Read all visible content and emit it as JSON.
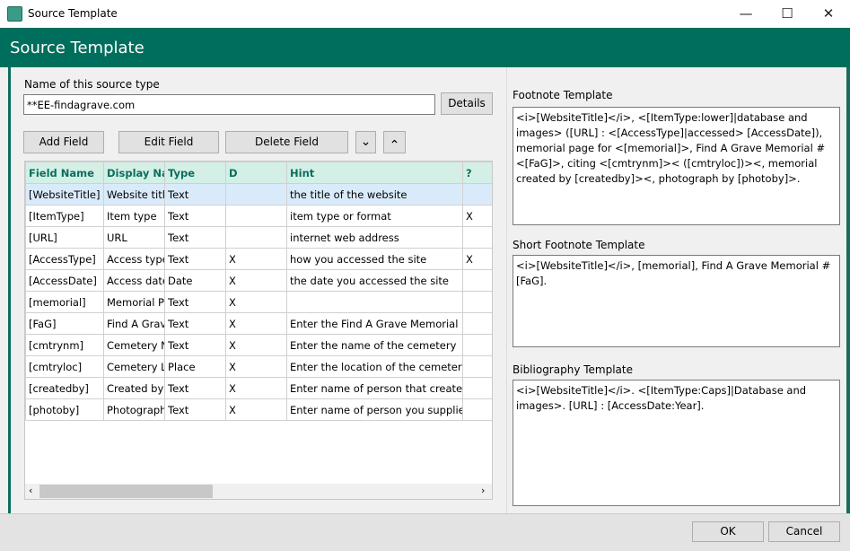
{
  "window": {
    "title": "Source Template",
    "minimize": "—",
    "maximize": "☐",
    "close": "✕"
  },
  "header": {
    "title": "Source Template"
  },
  "name_field": {
    "label": "Name of this source type",
    "value": "**EE-findagrave.com",
    "details_label": "Details"
  },
  "toolbar": {
    "add": "Add Field",
    "edit": "Edit Field",
    "delete": "Delete Field",
    "move_down": "⌄",
    "move_up": "⌃"
  },
  "table": {
    "columns": [
      "Field Name",
      "Display Name",
      "Type",
      "D",
      "Hint",
      "?"
    ],
    "rows": [
      [
        "[WebsiteTitle]",
        "Website title",
        "Text",
        "",
        "the title of the website",
        ""
      ],
      [
        "[ItemType]",
        "Item type",
        "Text",
        "",
        "item type or format",
        "X"
      ],
      [
        "[URL]",
        "URL",
        "Text",
        "",
        "internet web address",
        ""
      ],
      [
        "[AccessType]",
        "Access type",
        "Text",
        "X",
        "how you accessed the site",
        "X"
      ],
      [
        "[AccessDate]",
        "Access date",
        "Date",
        "X",
        "the date you accessed the site",
        ""
      ],
      [
        "[memorial]",
        "Memorial Page",
        "Text",
        "X",
        "",
        ""
      ],
      [
        "[FaG]",
        "Find A Grave",
        "Text",
        "X",
        "Enter the Find A Grave Memorial #",
        ""
      ],
      [
        "[cmtrynm]",
        "Cemetery Name",
        "Text",
        "X",
        "Enter the name of the cemetery",
        ""
      ],
      [
        "[cmtryloc]",
        "Cemetery Location",
        "Place",
        "X",
        "Enter the location of the cemetery",
        ""
      ],
      [
        "[createdby]",
        "Created by",
        "Text",
        "X",
        "Enter name of person that created memorial",
        ""
      ],
      [
        "[photoby]",
        "Photograph",
        "Text",
        "X",
        "Enter name of person you supplied photo",
        ""
      ]
    ],
    "selected_row": 0,
    "scroll_left": "‹",
    "scroll_right": "›"
  },
  "footnote": {
    "label": "Footnote Template",
    "value": "<i>[WebsiteTitle]</i>, <[ItemType:lower]|database and images> ([URL] : <[AccessType]|accessed> [AccessDate]), memorial page for <[memorial]>, Find A Grave Memorial # <[FaG]>,  citing <[cmtrynm]>< ([cmtryloc])><, memorial created by [createdby]><, photograph by [photoby]>."
  },
  "short_footnote": {
    "label": "Short Footnote Template",
    "value": "<i>[WebsiteTitle]</i>, [memorial], Find A Grave Memorial # [FaG]."
  },
  "bibliography": {
    "label": "Bibliography Template",
    "value": "<i>[WebsiteTitle]</i>. <[ItemType:Caps]|Database and images>. [URL] : [AccessDate:Year]."
  },
  "footer": {
    "ok": "OK",
    "cancel": "Cancel"
  },
  "colors": {
    "brand": "#006e5c",
    "header_row": "#d4efe6",
    "selected_row": "#d9ebfb"
  }
}
